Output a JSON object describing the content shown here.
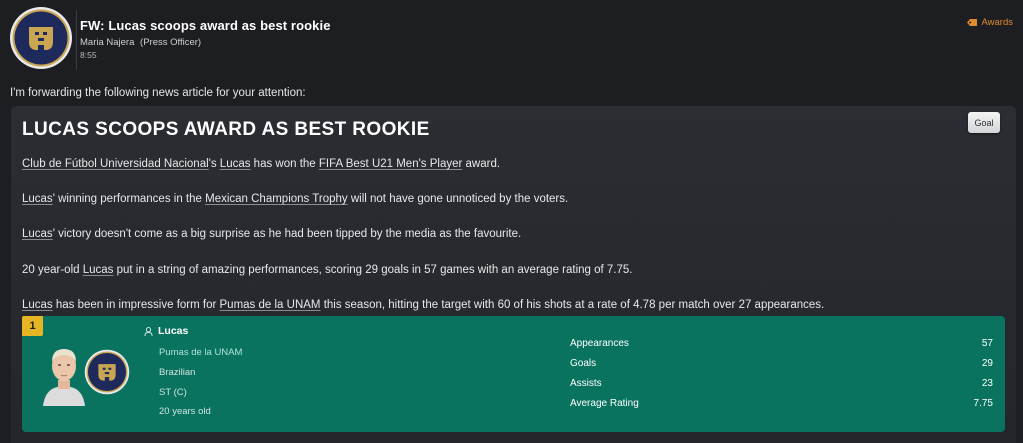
{
  "header": {
    "subject": "FW: Lucas scoops award as best rookie",
    "sender_name": "Maria Najera",
    "sender_role": "(Press Officer)",
    "time": "8:55",
    "tag_label": "Awards",
    "tag_color": "#e08a2e"
  },
  "intro": "I'm forwarding the following news article for your attention:",
  "article": {
    "headline": "LUCAS SCOOPS AWARD AS BEST ROOKIE",
    "goal_button": "Goal",
    "p1": {
      "club": "Club de Fútbol Universidad Nacional",
      "t1": "'s ",
      "player": "Lucas",
      "t2": " has won the ",
      "award": "FIFA Best U21 Men's Player",
      "t3": " award."
    },
    "p2": {
      "player": "Lucas",
      "t1": "' winning performances in the ",
      "competition": "Mexican Champions Trophy",
      "t2": " will not have gone unnoticed by the voters."
    },
    "p3": {
      "player": "Lucas",
      "t1": "' victory doesn't come as a big surprise as he had been tipped by the media as the favourite."
    },
    "p4": {
      "t1": "20 year-old ",
      "player": "Lucas",
      "t2": " put in a string of amazing performances, scoring 29 goals in 57 games with an average rating of 7.75."
    },
    "p5": {
      "player": "Lucas",
      "t1": " has been in impressive form for ",
      "club": "Pumas de la UNAM",
      "t2": " this season, hitting the target with 60 of his shots at a rate of 4.78 per match over 27 appearances."
    }
  },
  "card": {
    "rank": "1",
    "name": "Lucas",
    "club": "Pumas de la UNAM",
    "nationality": "Brazilian",
    "position": "ST (C)",
    "age": "20 years old",
    "stats": [
      {
        "label": "Appearances",
        "value": "57"
      },
      {
        "label": "Goals",
        "value": "29"
      },
      {
        "label": "Assists",
        "value": "23"
      },
      {
        "label": "Average Rating",
        "value": "7.75"
      }
    ],
    "accent_color": "#0a7360",
    "rank_color": "#e6b523"
  }
}
